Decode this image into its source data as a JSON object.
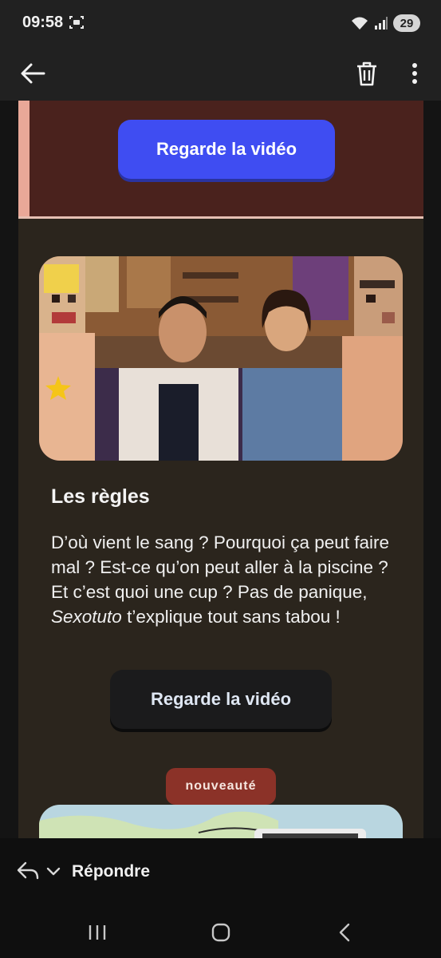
{
  "status_bar": {
    "time": "09:58",
    "battery": "29"
  },
  "app_bar": {
    "back_icon": "arrow-left-icon",
    "delete_icon": "trash-icon",
    "more_icon": "more-vert-icon"
  },
  "email": {
    "top_button_label": "Regarde la vidéo",
    "card": {
      "title": "Les règles",
      "description_part1": "D’où vient le sang ? Pourquoi ça peut faire mal ? Est-ce qu’on peut aller à la piscine ? Et c’est quoi une cup ? Pas de panique, ",
      "description_brand": "Sexotuto",
      "description_part2": " t’explique tout sans tabou !",
      "button_label": "Regarde la vidéo"
    },
    "badge": "nouveauté"
  },
  "reply_bar": {
    "label": "Répondre"
  },
  "colors": {
    "accent_blue": "#3f4df2",
    "card_background": "#2b251d",
    "banner_background": "#4a221d",
    "badge": "#8b3228"
  }
}
